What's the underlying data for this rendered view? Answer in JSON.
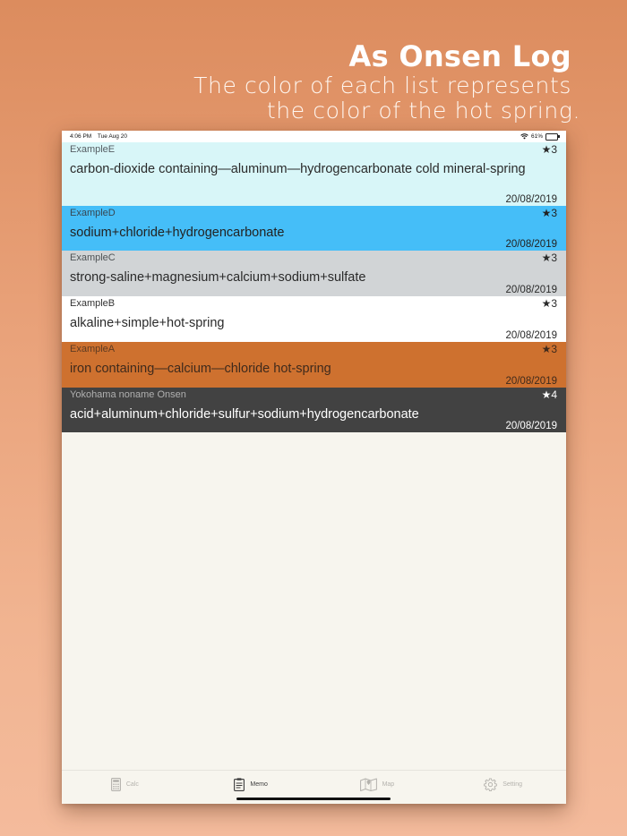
{
  "headline": {
    "title": "As Onsen Log",
    "subtitle_line1": "The color of each list represents",
    "subtitle_line2": "the color of the hot spring."
  },
  "status_bar": {
    "time": "4:06 PM",
    "date": "Tue Aug 20",
    "battery": "61%",
    "battery_level": 0.61
  },
  "onsen_list": [
    {
      "name": "ExampleE",
      "composition": "carbon-dioxide containing—aluminum—hydrogencarbonate cold mineral-spring",
      "rating": "★3",
      "date": "20/08/2019",
      "bg_color": "#d8f6f8",
      "name_color": "#555d63",
      "text_color": "#2a2a2a"
    },
    {
      "name": "ExampleD",
      "composition": "sodium+chloride+hydrogencarbonate",
      "rating": "★3",
      "date": "20/08/2019",
      "bg_color": "#45bef8",
      "name_color": "#374752",
      "text_color": "#222222"
    },
    {
      "name": "ExampleC",
      "composition": "strong-saline+magnesium+calcium+sodium+sulfate",
      "rating": "★3",
      "date": "20/08/2019",
      "bg_color": "#d1d4d6",
      "name_color": "#4f5356",
      "text_color": "#2a2a2a"
    },
    {
      "name": "ExampleB",
      "composition": "alkaline+simple+hot-spring",
      "rating": "★3",
      "date": "20/08/2019",
      "bg_color": "#ffffff",
      "name_color": "#333333",
      "text_color": "#2a2a2a"
    },
    {
      "name": "ExampleA",
      "composition": "iron containing—calcium—chloride hot-spring",
      "rating": "★3",
      "date": "20/08/2019",
      "bg_color": "#ce712f",
      "name_color": "#5e3b22",
      "text_color": "#3f2a1c"
    },
    {
      "name": "Yokohama noname Onsen",
      "composition": "acid+aluminum+chloride+sulfur+sodium+hydrogencarbonate",
      "rating": "★4",
      "date": "20/08/2019",
      "bg_color": "#424242",
      "name_color": "#b0b0b0",
      "text_color": "#ffffff"
    }
  ],
  "tab_bar": [
    {
      "label": "Calc",
      "icon": "calculator-icon",
      "active": false
    },
    {
      "label": "Memo",
      "icon": "memo-icon",
      "active": true
    },
    {
      "label": "Map",
      "icon": "map-icon",
      "active": false
    },
    {
      "label": "Setting",
      "icon": "gear-icon",
      "active": false
    }
  ]
}
